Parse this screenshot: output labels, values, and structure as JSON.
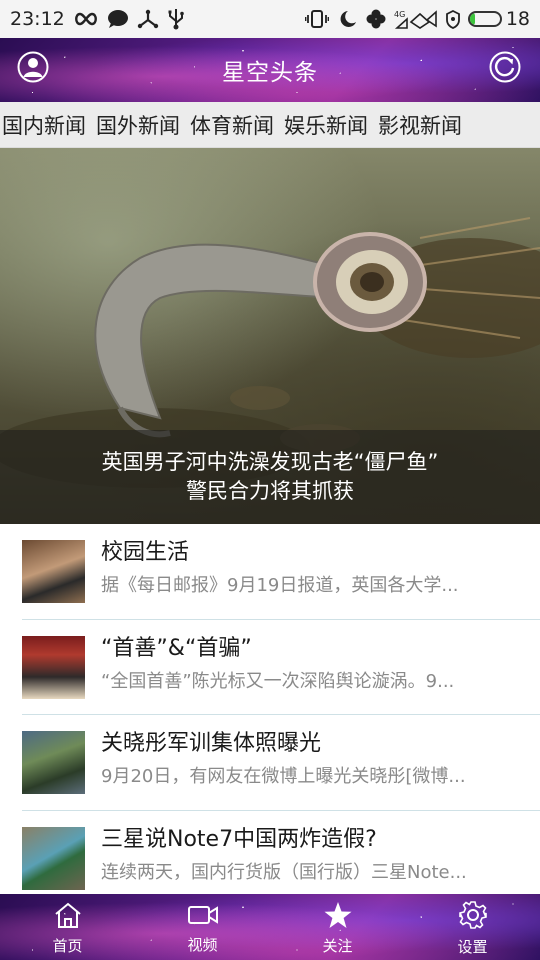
{
  "status_bar": {
    "time": "23:12",
    "battery_level": "18",
    "battery_fraction": 0.18,
    "left_icons": [
      "infinity-icon",
      "chat-bubble-icon",
      "usb-tether-icon",
      "usb-icon"
    ],
    "right_icons": [
      "vibrate-icon",
      "moon-icon",
      "clover-icon",
      "signal-4g-icon",
      "alarm-icon",
      "battery-icon"
    ]
  },
  "header": {
    "title": "星空头条",
    "left_icon": "user-avatar-icon",
    "right_icon": "refresh-icon"
  },
  "tabs": [
    {
      "label": "国内新闻"
    },
    {
      "label": "国外新闻"
    },
    {
      "label": "体育新闻"
    },
    {
      "label": "娱乐新闻"
    },
    {
      "label": "影视新闻"
    }
  ],
  "hero": {
    "caption_line1": "英国男子河中洗澡发现古老“僵尸鱼”",
    "caption_line2": "警民合力将其抓获"
  },
  "news": [
    {
      "title": "校园生活",
      "summary": "据《每日邮报》9月19日报道，英国各大学..."
    },
    {
      "title": "“首善”&“首骗”",
      "summary": "“全国首善”陈光标又一次深陷舆论漩涡。9..."
    },
    {
      "title": "关晓彤军训集体照曝光",
      "summary": "9月20日，有网友在微博上曝光关晓彤[微博..."
    },
    {
      "title": "三星说Note7中国两炸造假?",
      "summary": "连续两天，国内行货版（国行版）三星Note..."
    }
  ],
  "bottom_nav": [
    {
      "label": "首页",
      "icon": "home-icon"
    },
    {
      "label": "视频",
      "icon": "video-camera-icon"
    },
    {
      "label": "关注",
      "icon": "star-icon"
    },
    {
      "label": "设置",
      "icon": "gear-icon"
    }
  ],
  "colors": {
    "header_bg": "#5a1f88",
    "tab_bar_bg": "#ececec",
    "divider": "#cfe1e6",
    "battery_fill": "#3cc43c",
    "summary_text": "#8a8a8a"
  }
}
